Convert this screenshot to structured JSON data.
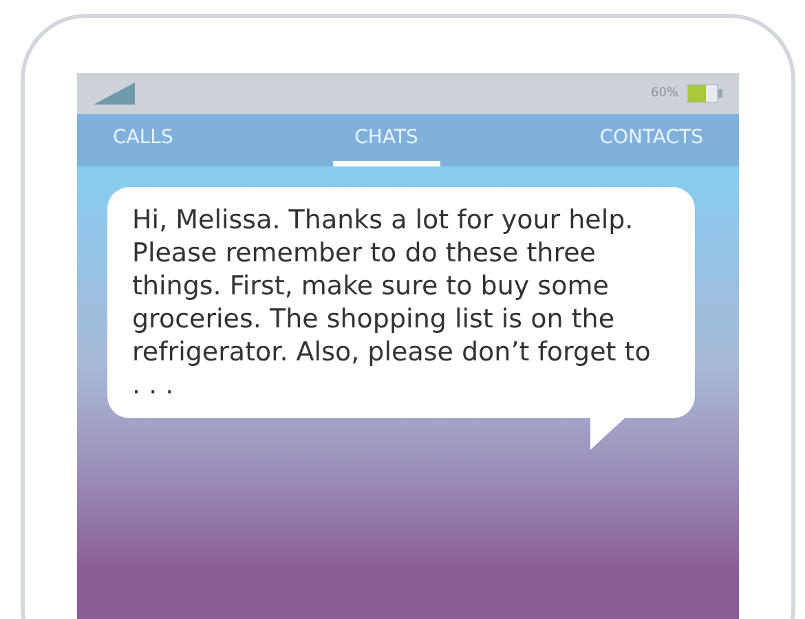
{
  "status_bar": {
    "battery_text": "60%"
  },
  "tabs": [
    {
      "label": "CALLS",
      "selected": false
    },
    {
      "label": "CHATS",
      "selected": true
    },
    {
      "label": "CONTACTS",
      "selected": false
    }
  ],
  "message": {
    "text": "Hi, Melissa. Thanks a lot for your help. Please remember to do these three things. First, make sure to buy some groceries. The shopping list is on the refrigerator. Also, please don’t forget to . . ."
  }
}
